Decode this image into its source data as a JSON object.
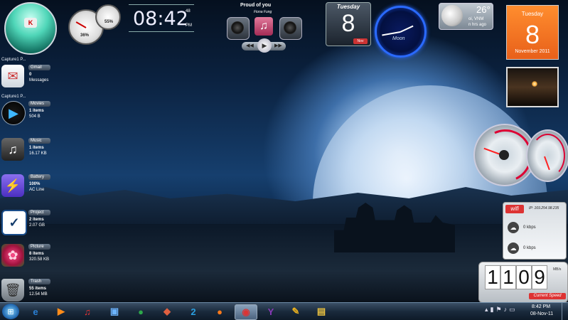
{
  "desktop": {
    "wallpaper": "night castle under moon"
  },
  "sidebar": {
    "caption1": "Capture1 P...",
    "caption2": "Capture1 P...",
    "items": [
      {
        "title": "Gmail",
        "line1": "0",
        "line2": "Messages",
        "icon": "envelope-icon"
      },
      {
        "title": "Movies",
        "line1": "1 items",
        "line2": "504 B",
        "icon": "play-icon"
      },
      {
        "title": "Music",
        "line1": "1 items",
        "line2": "16.17 KB",
        "icon": "music-note-icon"
      },
      {
        "title": "Battery",
        "line1": "100%",
        "line2": "AC Line",
        "icon": "lightning-icon"
      },
      {
        "title": "Project",
        "line1": "2 items",
        "line2": "2.07 GB",
        "icon": "checkbox-icon"
      },
      {
        "title": "Picture",
        "line1": "8 items",
        "line2": "320.58 KB",
        "icon": "flower-icon"
      },
      {
        "title": "Trash",
        "line1": "55 items",
        "line2": "12.54 MB",
        "icon": "trash-icon"
      }
    ]
  },
  "gauges": {
    "cpu": "36%",
    "mem": "55%"
  },
  "clock": {
    "time": "08:42",
    "seconds": "48",
    "ampm": "PM"
  },
  "player": {
    "song": "Proud of you",
    "artist": "Fiona Fung"
  },
  "flip_calendar": {
    "day": "Tuesday",
    "date": "8",
    "month": "Nov"
  },
  "moon_clock": {
    "label": "Moon"
  },
  "weather": {
    "temp": "26°",
    "location": "oi, VNM",
    "updated": "n hrs ago"
  },
  "calendar": {
    "day": "Tuesday",
    "date": "8",
    "month_year": "November 2011"
  },
  "wifi": {
    "title": "wifi",
    "ip": "IP: 169.254.98.235",
    "up": "0 kbps",
    "down": "0 kbps"
  },
  "counter": {
    "digits": [
      "1",
      "1",
      "0",
      "9"
    ],
    "label": "Current Speed",
    "unit": "MB/s"
  },
  "taskbar": {
    "apps": [
      {
        "name": "internet-explorer-icon",
        "glyph": "e",
        "color": "#2a7fd4"
      },
      {
        "name": "media-player-icon",
        "glyph": "▶",
        "color": "#ff8c1a"
      },
      {
        "name": "media-monkey-icon",
        "glyph": "♫",
        "color": "#e33"
      },
      {
        "name": "computer-icon",
        "glyph": "▣",
        "color": "#6cb4ff"
      },
      {
        "name": "globe-icon",
        "glyph": "●",
        "color": "#2da84a"
      },
      {
        "name": "game-icon",
        "glyph": "◆",
        "color": "#e06040"
      },
      {
        "name": "app-2-icon",
        "glyph": "2",
        "color": "#2a9fe0"
      },
      {
        "name": "firefox-icon",
        "glyph": "●",
        "color": "#ff7a1a"
      },
      {
        "name": "gadget-app-icon",
        "glyph": "◉",
        "color": "#d33"
      },
      {
        "name": "yahoo-icon",
        "glyph": "Y",
        "color": "#8a3ab9"
      },
      {
        "name": "paint-icon",
        "glyph": "✎",
        "color": "#e8b020"
      },
      {
        "name": "explorer-folder-icon",
        "glyph": "▤",
        "color": "#e8c040"
      }
    ],
    "time": "8:42 PM",
    "date": "08-Nov-11"
  }
}
